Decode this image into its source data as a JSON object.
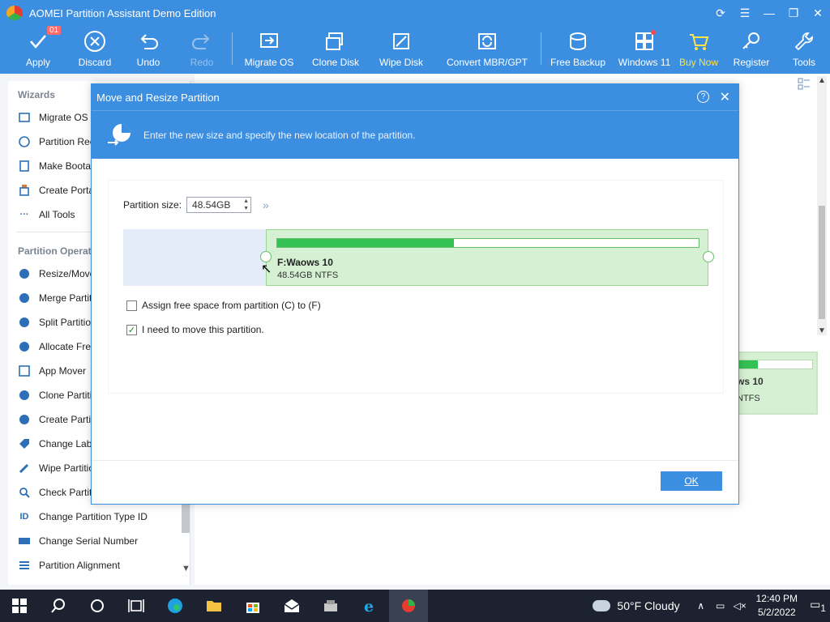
{
  "window": {
    "title": "AOMEI Partition Assistant Demo Edition"
  },
  "toolbar": {
    "apply": "Apply",
    "apply_badge": "01",
    "discard": "Discard",
    "undo": "Undo",
    "redo": "Redo",
    "migrate_os": "Migrate OS",
    "clone_disk": "Clone Disk",
    "wipe_disk": "Wipe Disk",
    "convert": "Convert MBR/GPT",
    "free_backup": "Free Backup",
    "windows11": "Windows 11",
    "buy_now": "Buy Now",
    "register": "Register",
    "tools": "Tools"
  },
  "sidebar": {
    "wizards_title": "Wizards",
    "wizards": [
      "Migrate OS to",
      "Partition Reco",
      "Make Bootab",
      "Create Porta",
      "All Tools"
    ],
    "operations_title": "Partition Operat",
    "operations": [
      "Resize/Move",
      "Merge Partitio",
      "Split Partition",
      "Allocate Free",
      "App Mover",
      "Clone Partitio",
      "Create Partiti",
      "Change Labe",
      "Wipe Partition",
      "Check Partitio",
      "Change Partition Type ID",
      "Change Serial Number",
      "Partition Alignment"
    ]
  },
  "background_disk": {
    "name": "ws 10",
    "size": "NTFS",
    "used_fraction": 0.25
  },
  "dialog": {
    "title": "Move and Resize Partition",
    "help": "?",
    "banner_text": "Enter the new size and specify the new location of the partition.",
    "size_label": "Partition size:",
    "size_value": "48.54GB",
    "partition_name": "F:Waows 10",
    "partition_info": "48.54GB NTFS",
    "used_fraction": 0.42,
    "assign_label": "Assign free space from partition (C) to (F)",
    "assign_checked": false,
    "move_label": "I need to move this partition.",
    "move_checked": true,
    "ok": "OK"
  },
  "taskbar": {
    "weather": "50°F  Cloudy",
    "time": "12:40 PM",
    "date": "5/2/2022",
    "notification_count": "1"
  },
  "colors": {
    "accent": "#3c8ee0",
    "used": "#34c053",
    "partition_bg": "#d6f0d3"
  }
}
